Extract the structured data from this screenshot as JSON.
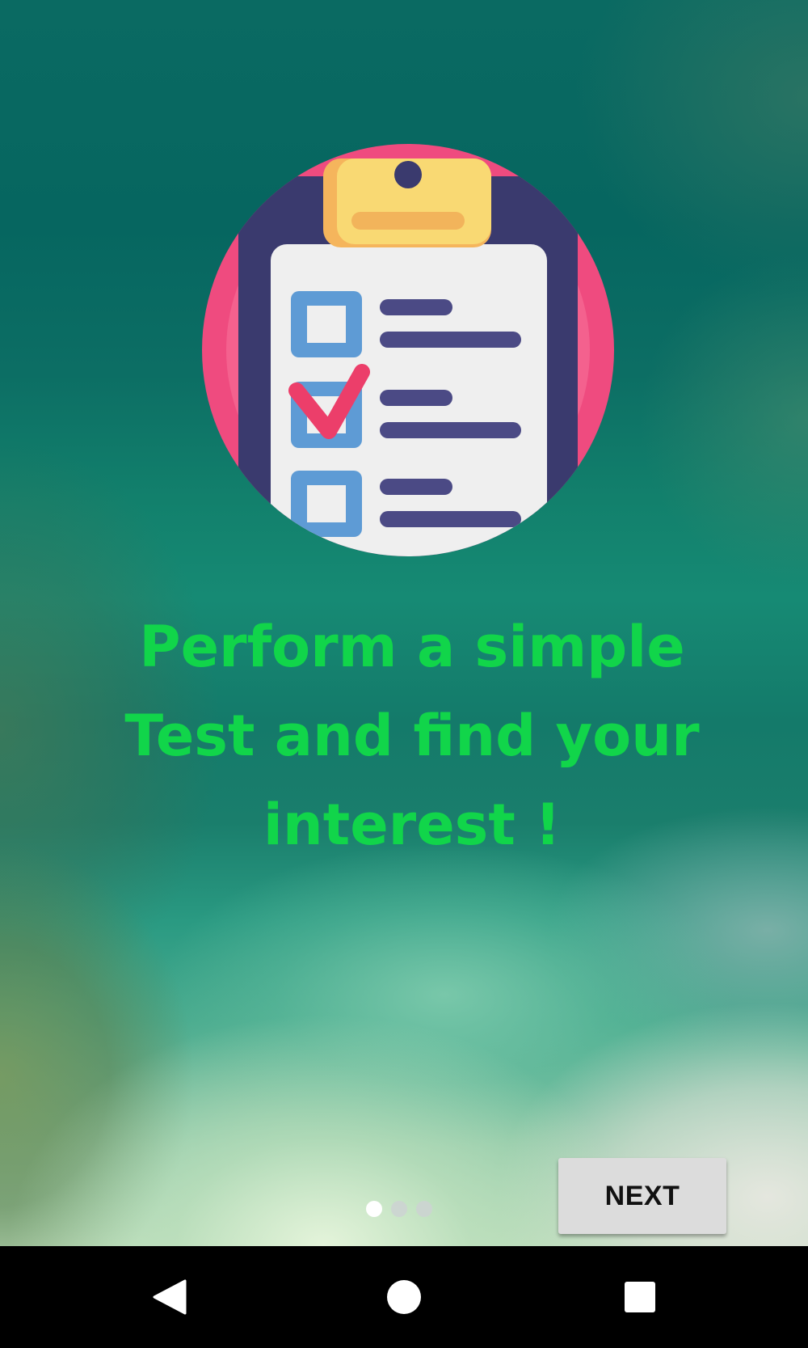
{
  "onboarding": {
    "headline": "Perform a simple Test and find your interest !",
    "next_label": "NEXT",
    "pages": 3,
    "current_page": 1
  },
  "colors": {
    "headline": "#11d54a",
    "circle": "#ef4b7f",
    "board": "#3a3a6e",
    "clip": "#f9d973",
    "checkbox": "#5e9bd5",
    "checkmark": "#ec3e6a",
    "lines": "#4b4a85"
  },
  "icons": {
    "illustration": "clipboard-checklist-icon",
    "back": "back-triangle-icon",
    "home": "home-circle-icon",
    "recents": "recents-square-icon"
  }
}
